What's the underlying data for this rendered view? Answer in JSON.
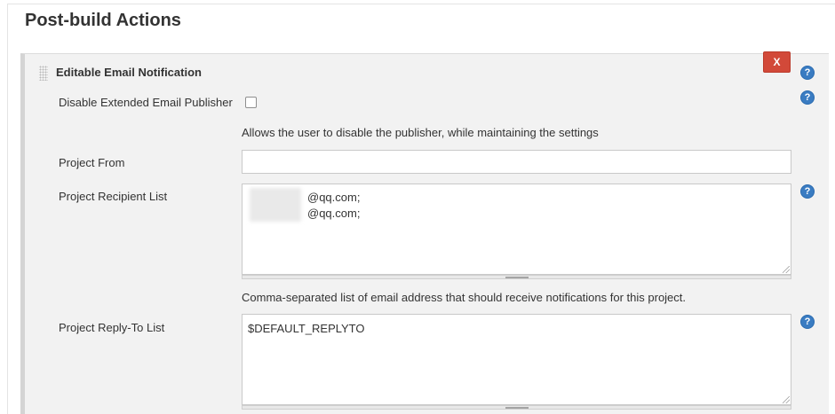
{
  "section": {
    "title": "Post-build Actions"
  },
  "block": {
    "title": "Editable Email Notification",
    "delete_label": "X",
    "help_glyph": "?"
  },
  "fields": {
    "disable_label": "Disable Extended Email Publisher",
    "disable_checked": false,
    "disable_description": "Allows the user to disable the publisher, while maintaining the settings",
    "project_from_label": "Project From",
    "project_from_value": "",
    "recipient_label": "Project Recipient List",
    "recipient_lines": [
      "@qq.com;",
      "@qq.com;"
    ],
    "recipient_description": "Comma-separated list of email address that should receive notifications for this project.",
    "reply_to_label": "Project Reply-To List",
    "reply_to_value": "$DEFAULT_REPLYTO"
  },
  "colors": {
    "delete_button": "#d24939",
    "help_icon": "#3a7cc2",
    "block_background": "#f2f2f2"
  }
}
